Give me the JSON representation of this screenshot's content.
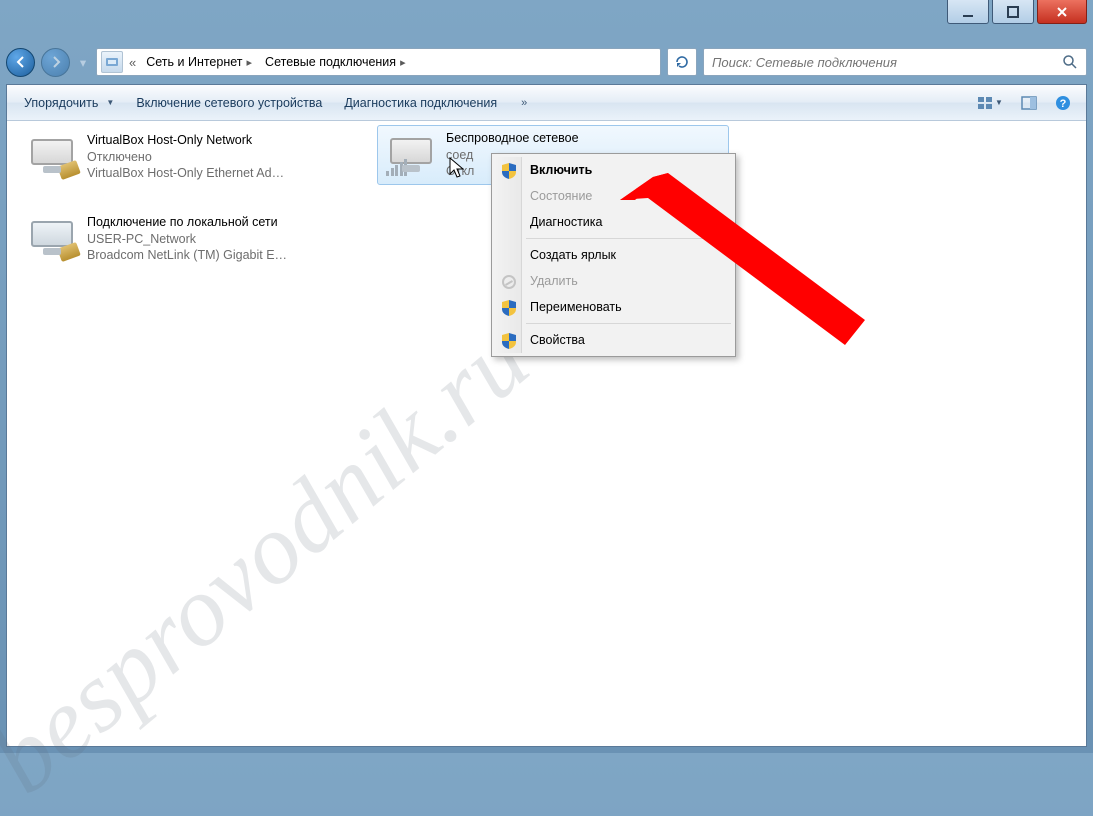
{
  "caption_buttons": {
    "min": "minimize",
    "max": "maximize",
    "close": "close"
  },
  "breadcrumb": {
    "start_glyph": "«",
    "items": [
      "Сеть и Интернет",
      "Сетевые подключения"
    ]
  },
  "search": {
    "placeholder": "Поиск: Сетевые подключения"
  },
  "toolbar": {
    "organize": "Упорядочить",
    "enable_device": "Включение сетевого устройства",
    "diagnose": "Диагностика подключения",
    "overflow": "»"
  },
  "connections": [
    {
      "id": "vbox",
      "title": "VirtualBox Host-Only Network",
      "status": "Отключено",
      "device": "VirtualBox Host-Only Ethernet Ad…"
    },
    {
      "id": "lan",
      "title": "Подключение по локальной сети",
      "status": "USER-PC_Network",
      "device": "Broadcom NetLink (TM) Gigabit E…"
    },
    {
      "id": "wifi",
      "title": "Беспроводное сетевое",
      "status_prefix": "соед",
      "status": "Откл"
    }
  ],
  "context_menu": {
    "enable": "Включить",
    "status": "Состояние",
    "diagnose": "Диагностика",
    "shortcut": "Создать ярлык",
    "delete": "Удалить",
    "rename": "Переименовать",
    "properties": "Свойства"
  },
  "watermark": "besprovodnik.ru"
}
